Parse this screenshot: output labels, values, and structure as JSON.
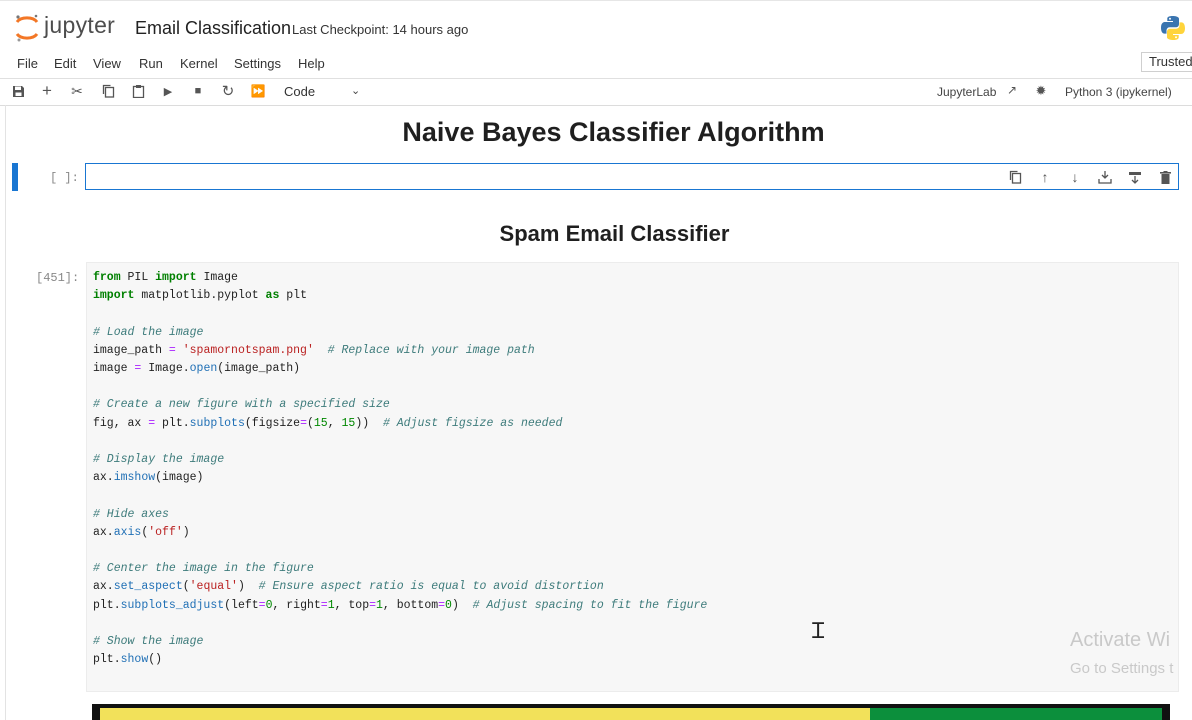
{
  "header": {
    "logo_text": "jupyter",
    "notebook_title": "Email Classification",
    "checkpoint": "Last Checkpoint: 14 hours ago",
    "trusted": "Trusted"
  },
  "menu": [
    "File",
    "Edit",
    "View",
    "Run",
    "Kernel",
    "Settings",
    "Help"
  ],
  "toolbar": {
    "cell_type": "Code",
    "jupyterlab": "JupyterLab",
    "kernel": "Python 3 (ipykernel)"
  },
  "notebook": {
    "heading1": "Naive Bayes Classifier Algorithm",
    "heading2": "Spam Email Classifier",
    "empty_cell_prompt": "[ ]:",
    "code_cell_prompt": "[451]:",
    "code": {
      "l1_a": "from",
      "l1_b": " PIL ",
      "l1_c": "import",
      "l1_d": " Image",
      "l2_a": "import",
      "l2_b": " matplotlib.pyplot ",
      "l2_c": "as",
      "l2_d": " plt",
      "c_load": "# Load the image",
      "l4_a": "image_path ",
      "l4_b": "=",
      "l4_c": " ",
      "l4_d": "'spamornotspam.png'",
      "l4_e": "  ",
      "l4_f": "# Replace with your image path",
      "l5_a": "image ",
      "l5_b": "=",
      "l5_c": " Image.",
      "l5_d": "open",
      "l5_e": "(image_path)",
      "c_fig": "# Create a new figure with a specified size",
      "l7_a": "fig, ax ",
      "l7_b": "=",
      "l7_c": " plt.",
      "l7_d": "subplots",
      "l7_e": "(figsize",
      "l7_f": "=",
      "l7_g": "(",
      "l7_h": "15",
      "l7_i": ", ",
      "l7_j": "15",
      "l7_k": "))  ",
      "l7_l": "# Adjust figsize as needed",
      "c_disp": "# Display the image",
      "l9_a": "ax.",
      "l9_b": "imshow",
      "l9_c": "(image)",
      "c_hide": "# Hide axes",
      "l11_a": "ax.",
      "l11_b": "axis",
      "l11_c": "(",
      "l11_d": "'off'",
      "l11_e": ")",
      "c_center": "# Center the image in the figure",
      "l13_a": "ax.",
      "l13_b": "set_aspect",
      "l13_c": "(",
      "l13_d": "'equal'",
      "l13_e": ")  ",
      "l13_f": "# Ensure aspect ratio is equal to avoid distortion",
      "l14_a": "plt.",
      "l14_b": "subplots_adjust",
      "l14_c": "(left",
      "l14_d": "=",
      "l14_e": "0",
      "l14_f": ", right",
      "l14_g": "=",
      "l14_h": "1",
      "l14_i": ", top",
      "l14_j": "=",
      "l14_k": "1",
      "l14_l": ", bottom",
      "l14_m": "=",
      "l14_n": "0",
      "l14_o": ")  ",
      "l14_p": "# Adjust spacing to fit the figure",
      "c_show": "# Show the image",
      "l16_a": "plt.",
      "l16_b": "show",
      "l16_c": "()"
    }
  },
  "watermark": {
    "line1": "Activate Wi",
    "line2": "Go to Settings t"
  },
  "colors": {
    "accent": "#1976d2",
    "keyword": "#008000",
    "comment": "#3d7b7b",
    "string": "#ba2121"
  }
}
